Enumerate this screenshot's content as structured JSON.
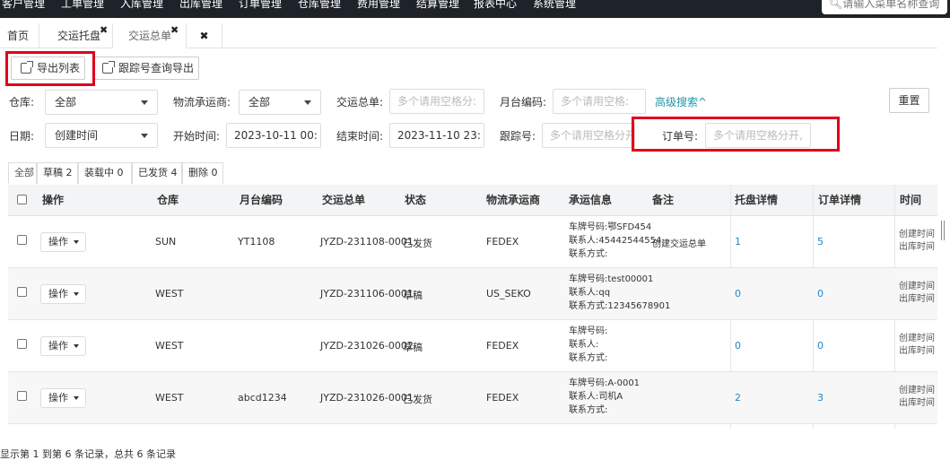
{
  "nav": {
    "menus": [
      "客户管理",
      "工单管理",
      "入库管理",
      "出库管理",
      "订单管理",
      "仓库管理",
      "费用管理",
      "结算管理",
      "报表中心",
      "系统管理"
    ],
    "search_placeholder": "请输入菜单名称查询"
  },
  "tabs": [
    {
      "label": "首页"
    },
    {
      "label": "交运托盘"
    },
    {
      "label": "交运总单"
    }
  ],
  "toolbar": {
    "export_list": "导出列表",
    "tracking_export": "跟踪号查询导出"
  },
  "filters": {
    "warehouse_label": "仓库:",
    "warehouse_value": "全部",
    "carrier_label": "物流承运商:",
    "carrier_value": "全部",
    "master_label": "交运总单:",
    "master_placeholder": "多个请用空格分:",
    "platform_label": "月台编码:",
    "platform_placeholder": "多个请用空格:",
    "advanced": "高级搜索^",
    "reset": "重置",
    "date_label": "日期:",
    "date_value": "创建时间",
    "start_label": "开始时间:",
    "start_value": "2023-10-11 00:",
    "end_label": "结束时间:",
    "end_value": "2023-11-10 23:",
    "tracking_label": "跟踪号:",
    "tracking_placeholder": "多个请用空格分开",
    "order_label": "订单号:",
    "order_placeholder": "多个请用空格分开,"
  },
  "status_tabs": [
    "全部",
    "草稿 2",
    "装载中 0",
    "已发货 4",
    "删除 0"
  ],
  "table": {
    "headers": [
      "操作",
      "仓库",
      "月台编码",
      "交运总单",
      "状态",
      "物流承运商",
      "承运信息",
      "备注",
      "托盘详情",
      "订单详情",
      "时间"
    ],
    "op_label": "操作",
    "rows": [
      {
        "warehouse": "SUN",
        "platform": "YT1108",
        "master": "JYZD-231108-0001",
        "status": "已发货",
        "carrier": "FEDEX",
        "info": [
          "车牌号码:鄂SFD454",
          "联系人:45442544554",
          "联系方式:"
        ],
        "remark": "创建交运总单",
        "pallets": "1",
        "orders": "5",
        "time": [
          "创建时间",
          "出库时间"
        ]
      },
      {
        "warehouse": "WEST",
        "platform": "",
        "master": "JYZD-231106-0001",
        "status": "草稿",
        "carrier": "US_SEKO",
        "info": [
          "车牌号码:test00001",
          "联系人:qq",
          "联系方式:12345678901"
        ],
        "remark": "",
        "pallets": "0",
        "orders": "0",
        "time": [
          "创建时间",
          "出库时间"
        ]
      },
      {
        "warehouse": "WEST",
        "platform": "",
        "master": "JYZD-231026-0002",
        "status": "草稿",
        "carrier": "FEDEX",
        "info": [
          "车牌号码:",
          "联系人:",
          "联系方式:"
        ],
        "remark": "",
        "pallets": "0",
        "orders": "0",
        "time": [
          "创建时间",
          "出库时间"
        ]
      },
      {
        "warehouse": "WEST",
        "platform": "abcd1234",
        "master": "JYZD-231026-0001",
        "status": "已发货",
        "carrier": "FEDEX",
        "info": [
          "车牌号码:A-0001",
          "联系人:司机A",
          "联系方式:"
        ],
        "remark": "",
        "pallets": "2",
        "orders": "3",
        "time": [
          "创建时间",
          "出库时间"
        ]
      }
    ]
  },
  "footer": "显示第 1 到第 6 条记录，总共 6 条记录"
}
